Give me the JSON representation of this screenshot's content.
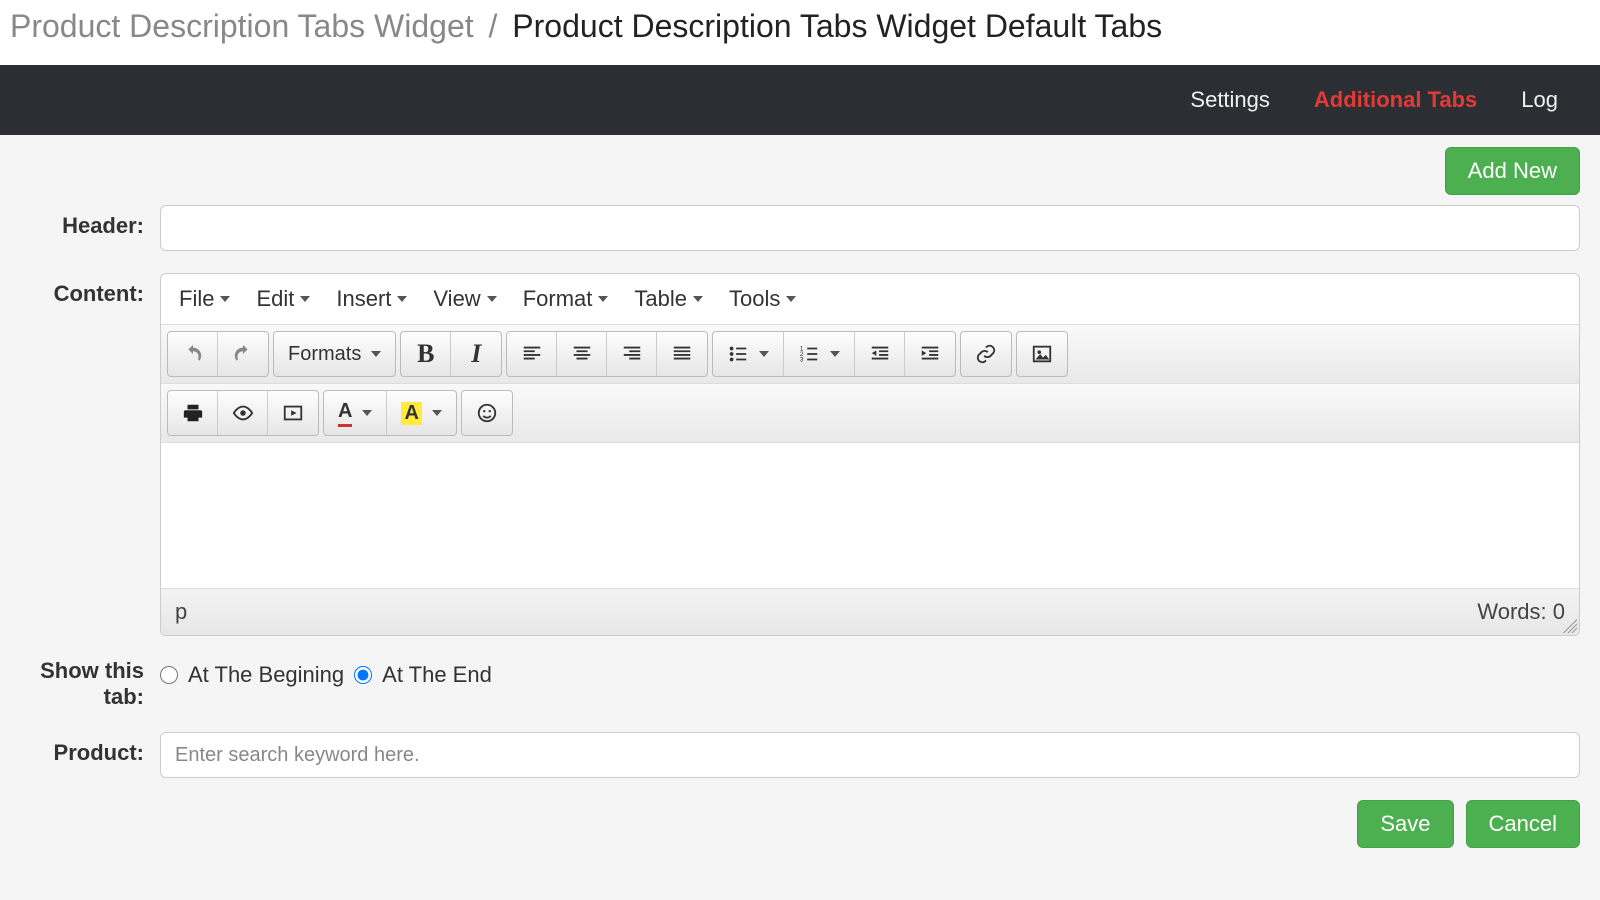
{
  "breadcrumb": {
    "parent": "Product Description Tabs Widget",
    "sep": "/",
    "current": "Product Description Tabs Widget Default Tabs"
  },
  "nav": {
    "settings": "Settings",
    "additional_tabs": "Additional Tabs",
    "log": "Log"
  },
  "buttons": {
    "add_new": "Add New",
    "save": "Save",
    "cancel": "Cancel"
  },
  "labels": {
    "header": "Header:",
    "content": "Content:",
    "show_tab": "Show this tab:",
    "product": "Product:"
  },
  "form": {
    "header_value": "",
    "product_placeholder": "Enter search keyword here.",
    "show_tab": {
      "begin": "At The Begining",
      "end": "At The End",
      "selected": "end"
    }
  },
  "editor": {
    "menus": {
      "file": "File",
      "edit": "Edit",
      "insert": "Insert",
      "view": "View",
      "format": "Format",
      "table": "Table",
      "tools": "Tools"
    },
    "formats_label": "Formats",
    "status_path": "p",
    "word_count": "Words: 0"
  }
}
